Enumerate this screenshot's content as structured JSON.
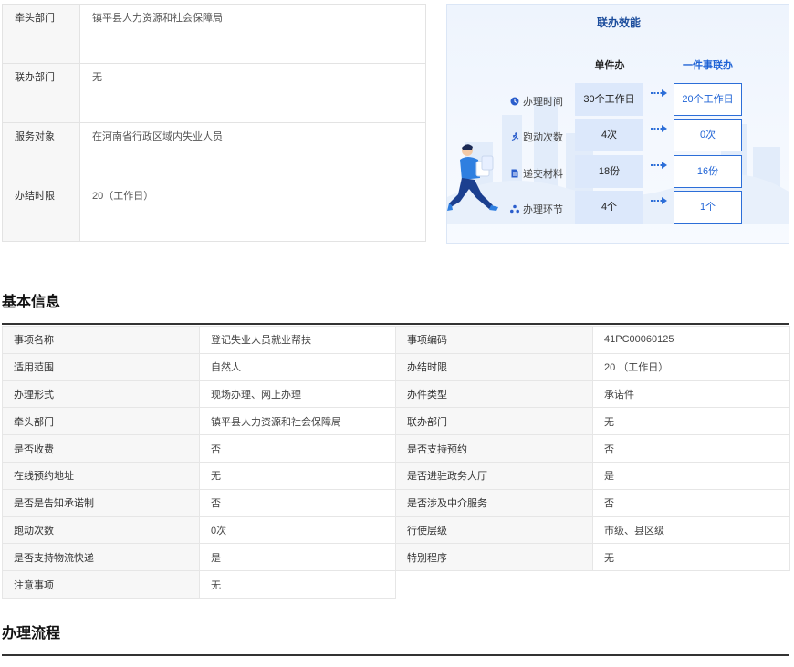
{
  "top_info": [
    {
      "label": "牵头部门",
      "value": "镇平县人力资源和社会保障局"
    },
    {
      "label": "联办部门",
      "value": "无"
    },
    {
      "label": "服务对象",
      "value": "在河南省行政区域内失业人员"
    },
    {
      "label": "办结时限",
      "value": "20（工作日）"
    }
  ],
  "efficiency": {
    "title": "联办效能",
    "col_single": "单件办",
    "col_joint": "一件事联办",
    "rows": [
      {
        "icon": "clock-icon",
        "label": "办理时间",
        "single": "30个工作日",
        "joint": "20个工作日"
      },
      {
        "icon": "running-icon",
        "label": "跑动次数",
        "single": "4次",
        "joint": "0次"
      },
      {
        "icon": "document-icon",
        "label": "递交材料",
        "single": "18份",
        "joint": "16份"
      },
      {
        "icon": "nodes-icon",
        "label": "办理环节",
        "single": "4个",
        "joint": "1个"
      }
    ],
    "accent": "#2064d6"
  },
  "basic_info": {
    "heading": "基本信息",
    "rows": [
      [
        "事项名称",
        "登记失业人员就业帮扶",
        "事项编码",
        "41PC00060125"
      ],
      [
        "适用范围",
        "自然人",
        "办结时限",
        "20 （工作日）"
      ],
      [
        "办理形式",
        "现场办理、网上办理",
        "办件类型",
        "承诺件"
      ],
      [
        "牵头部门",
        "镇平县人力资源和社会保障局",
        "联办部门",
        "无"
      ],
      [
        "是否收费",
        "否",
        "是否支持预约",
        "否"
      ],
      [
        "在线预约地址",
        "无",
        "是否进驻政务大厅",
        "是"
      ],
      [
        "是否是告知承诺制",
        "否",
        "是否涉及中介服务",
        "否"
      ],
      [
        "跑动次数",
        "0次",
        "行使层级",
        "市级、县区级"
      ],
      [
        "是否支持物流快递",
        "是",
        "特别程序",
        "无"
      ],
      [
        "注意事项",
        "无"
      ]
    ]
  },
  "process": {
    "heading": "办理流程"
  }
}
